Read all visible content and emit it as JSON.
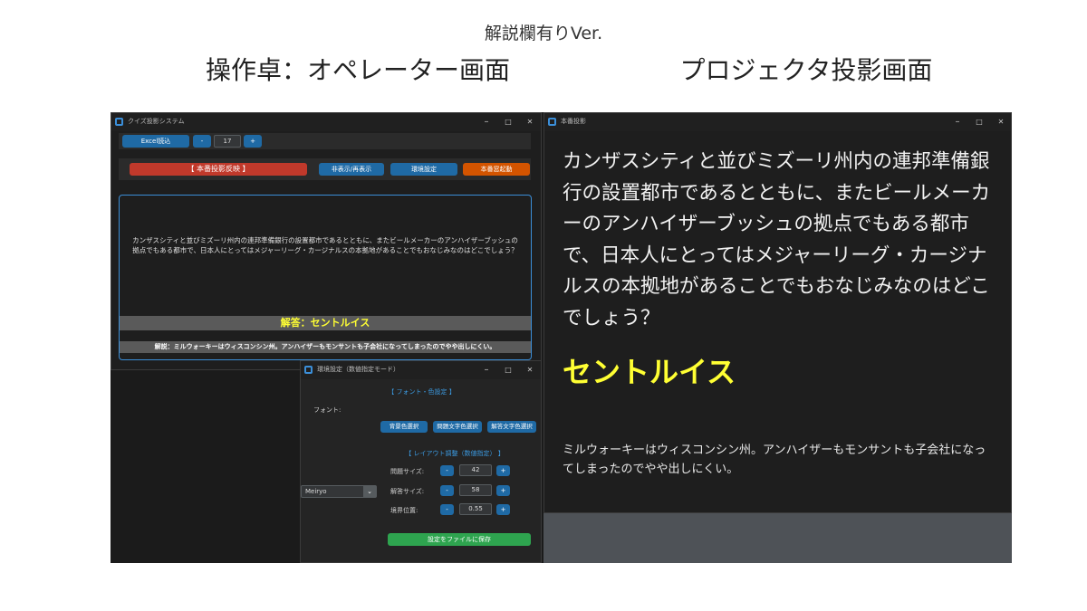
{
  "header": {
    "subtitle": "解説欄有りVer.",
    "left_title": "操作卓：オペレーター画面",
    "right_title": "プロジェクタ投影画面"
  },
  "operator_window": {
    "title": "クイズ投影システム",
    "excel_button": "Excel読込",
    "minus": "-",
    "plus": "+",
    "question_number": "17",
    "project_button": "【 本番投影反映 】",
    "toggle_button": "非表示/再表示",
    "env_button": "環境設定",
    "launch_button": "本番窓起動",
    "question_text": "カンザスシティと並びミズーリ州内の連邦準備銀行の設置都市であるとともに、またビールメーカーのアンハイザーブッシュの拠点でもある都市で、日本人にとってはメジャーリーグ・カージナルスの本拠地があることでもおなじみなのはどこでしょう？",
    "answer_text": "解答：セントルイス",
    "commentary_text": "解説：ミルウォーキーはウィスコンシン州。アンハイザーもモンサントも子会社になってしまったのでやや出しにくい。"
  },
  "settings_window": {
    "title": "環境設定（数値指定モード）",
    "font_section": "【 フォント・色設定 】",
    "font_label": "フォント:",
    "font_value": "Meiryo",
    "bg_color_button": "背景色選択",
    "question_color_button": "問題文字色選択",
    "answer_color_button": "解答文字色選択",
    "layout_section": "【 レイアウト調整（数値指定） 】",
    "question_size_label": "問題サイズ:",
    "question_size_value": "42",
    "answer_size_label": "解答サイズ:",
    "answer_size_value": "58",
    "boundary_label": "境界位置:",
    "boundary_value": "0.55",
    "minus": "-",
    "plus": "+",
    "save_button": "設定をファイルに保存"
  },
  "projection_window": {
    "title": "本番投影",
    "question_text": "カンザスシティと並びミズーリ州内の連邦準備銀行の設置都市であるとともに、またビールメーカーのアンハイザーブッシュの拠点でもある都市で、日本人にとってはメジャーリーグ・カージナルスの本拠地があることでもおなじみなのはどこでしょう？",
    "answer_text": "セントルイス",
    "commentary_text": "ミルウォーキーはウィスコンシン州。アンハイザーもモンサントも子会社になってしまったのでやや出しにくい。"
  },
  "window_controls": {
    "minimize": "–",
    "maximize": "□",
    "close": "✕"
  },
  "colors": {
    "accent_blue": "#1f6aa5",
    "project_red": "#c0392b",
    "launch_orange": "#d35400",
    "save_green": "#2ea44f",
    "answer_yellow": "#ffff33",
    "section_blue": "#3b9ae1"
  }
}
